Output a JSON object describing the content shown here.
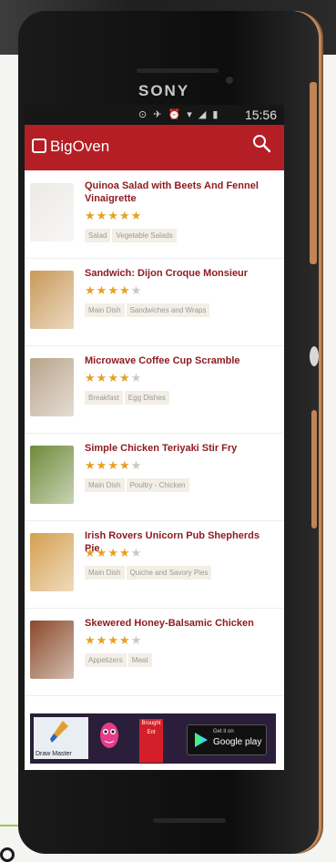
{
  "device": {
    "brand": "SONY"
  },
  "statusbar": {
    "icons": "⊙ ✈ ⏰ ▾ ◢ ▮",
    "time": "15:56"
  },
  "appbar": {
    "title": "BigOven"
  },
  "recipes": [
    {
      "title": "Quinoa Salad with Beets And Fennel Vinaigrette",
      "rating": 5,
      "tags": [
        "Salad",
        "Vegetable Salads"
      ],
      "thumb_color": "#eceae6"
    },
    {
      "title": "Sandwich: Dijon Croque Monsieur",
      "rating": 3.5,
      "tags": [
        "Main Dish",
        "Sandwiches and Wraps"
      ],
      "thumb_color": "#c99a5a"
    },
    {
      "title": "Microwave Coffee Cup Scramble",
      "rating": 4,
      "tags": [
        "Breakfast",
        "Egg Dishes"
      ],
      "thumb_color": "#b8a48a"
    },
    {
      "title": "Simple Chicken Teriyaki Stir Fry",
      "rating": 4,
      "tags": [
        "Main Dish",
        "Poultry - Chicken"
      ],
      "thumb_color": "#6e8a3a"
    },
    {
      "title": "Irish Rovers Unicorn Pub Shepherds Pie",
      "rating": 4,
      "tags": [
        "Main Dish",
        "Quiche and Savory Pies"
      ],
      "thumb_color": "#d4a050"
    },
    {
      "title": "Skewered Honey-Balsamic Chicken",
      "rating": 4,
      "tags": [
        "Appetizers",
        "Meat"
      ],
      "thumb_color": "#8a4a2a"
    }
  ],
  "ad": {
    "left_label": "Draw Master",
    "gplay_small": "Get it on",
    "gplay_big": "Google play",
    "red_text": "Brought Ent"
  },
  "colors": {
    "accent": "#b41e25",
    "title_text": "#8e1a1f",
    "star": "#e8a020"
  }
}
